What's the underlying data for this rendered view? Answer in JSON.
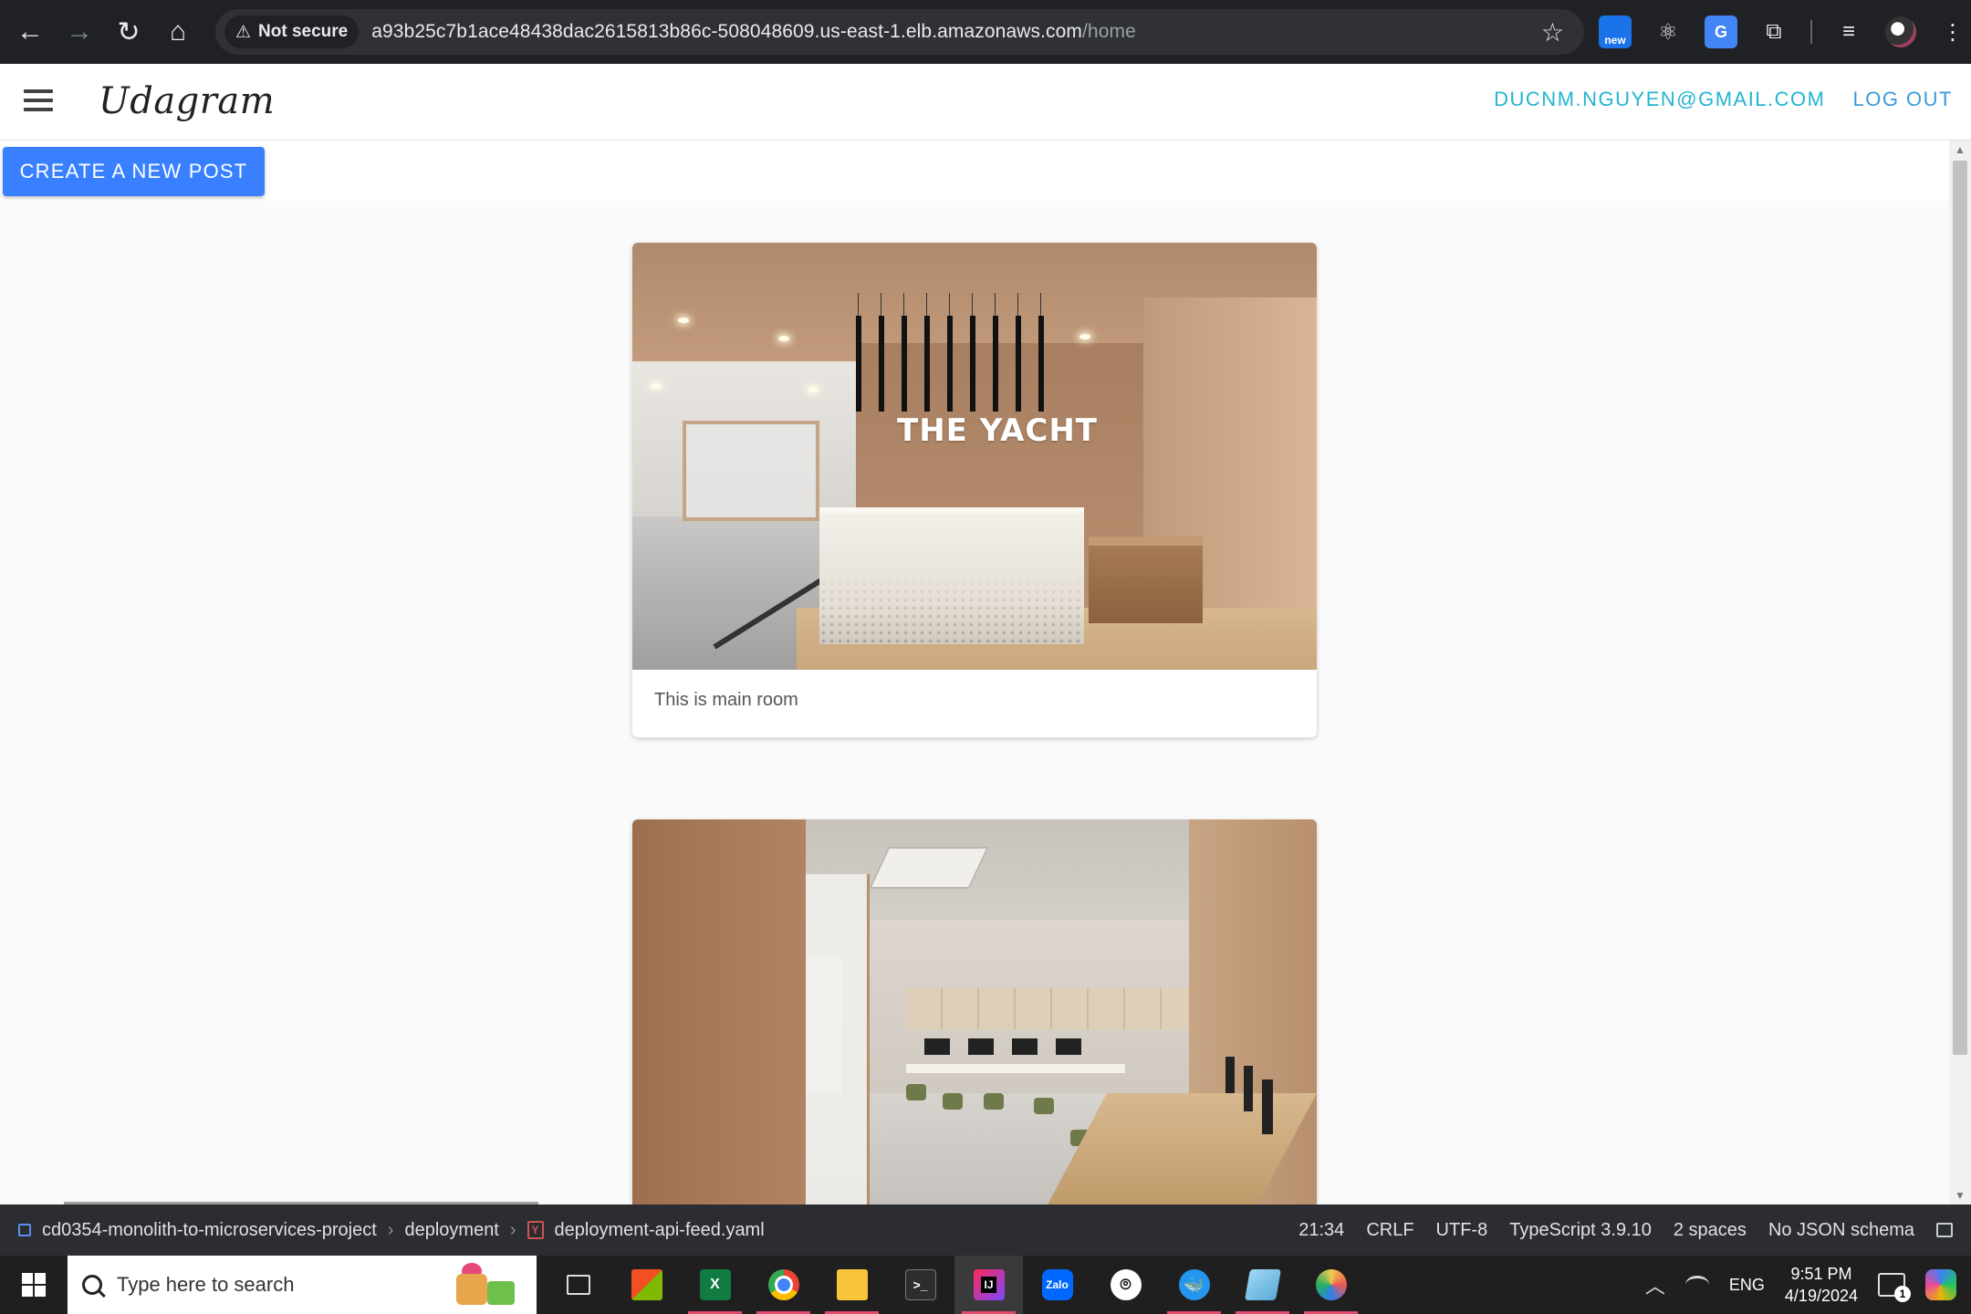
{
  "browser": {
    "security_label": "Not secure",
    "url_host": "a93b25c7b1ace48438dac2615813b86c-508048609.us-east-1.elb.amazonaws.com",
    "url_path": "/home",
    "ext_badge": "new",
    "translate_label": "G"
  },
  "app": {
    "brand": "Udagram",
    "email": "DUCNM.NGUYEN@GMAIL.COM",
    "logout_label": "LOG OUT",
    "create_post_label": "CREATE A NEW POST",
    "accent_color": "#3880ff"
  },
  "feed": {
    "posts": [
      {
        "image_text": "THE YACHT",
        "caption": "This is main room"
      },
      {
        "image_text": "",
        "caption": ""
      }
    ]
  },
  "ide_status": {
    "project": "cd0354-monolith-to-microservices-project",
    "folder": "deployment",
    "file_icon": "Y",
    "file": "deployment-api-feed.yaml",
    "position": "21:34",
    "line_ending": "CRLF",
    "encoding": "UTF-8",
    "language": "TypeScript 3.9.10",
    "indent": "2 spaces",
    "schema": "No JSON schema"
  },
  "taskbar": {
    "search_placeholder": "Type here to search",
    "apps": [
      {
        "name": "task-view-icon"
      },
      {
        "name": "microsoft-store-icon"
      },
      {
        "name": "excel-icon",
        "label": "X"
      },
      {
        "name": "chrome-icon"
      },
      {
        "name": "file-explorer-icon"
      },
      {
        "name": "terminal-icon",
        "label": ">_"
      },
      {
        "name": "intellij-idea-icon",
        "label": "IJ"
      },
      {
        "name": "zalo-icon",
        "label": "Zalo"
      },
      {
        "name": "github-desktop-icon",
        "label": "⌾"
      },
      {
        "name": "docker-icon",
        "label": "🐳"
      },
      {
        "name": "notepad-icon"
      },
      {
        "name": "paint-icon"
      }
    ],
    "language": "ENG",
    "time": "9:51 PM",
    "date": "4/19/2024",
    "notification_count": "1"
  }
}
